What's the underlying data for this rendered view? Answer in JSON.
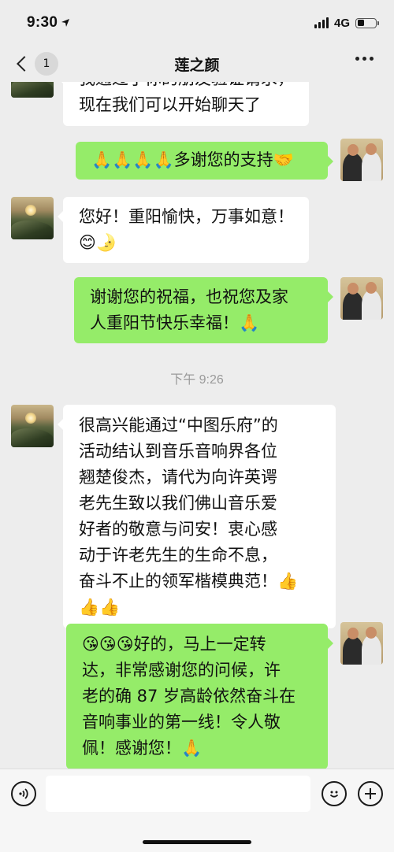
{
  "status_bar": {
    "time": "9:30",
    "network": "4G"
  },
  "nav": {
    "title": "莲之颜",
    "unread_count": "1"
  },
  "messages": [
    {
      "side": "in",
      "lines": [
        "我通过了你的朋友验证请求，",
        "现在我们可以开始聊天了"
      ]
    },
    {
      "side": "out",
      "lines": [
        "🙏🙏🙏🙏多谢您的支持🤝"
      ]
    },
    {
      "side": "in",
      "lines": [
        "您好！重阳愉快，万事如意！",
        "😊🌛"
      ]
    },
    {
      "side": "out",
      "lines": [
        "谢谢您的祝福，也祝您及家",
        "人重阳节快乐幸福！🙏"
      ]
    },
    {
      "side": "in",
      "lines": [
        "很高兴能通过“中图乐府”的",
        "活动结认到音乐音响界各位",
        "翘楚俊杰，请代为向许英谔",
        "老先生致以我们佛山音乐爱",
        "好者的敬意与问安！衷心感",
        "动于许老先生的生命不息，",
        "奋斗不止的领军楷模典范！👍",
        "👍👍"
      ]
    },
    {
      "side": "out",
      "lines": [
        "😘😘😘好的，马上一定转",
        "达，非常感谢您的问候，许",
        "老的确 87 岁高龄依然奋斗在",
        "音响事业的第一线！令人敬",
        "佩！感谢您！🙏"
      ]
    }
  ],
  "time_divider": "下午 9:26",
  "input_bar": {
    "placeholder": ""
  },
  "icons": {
    "back": "chevron-left-icon",
    "more": "more-dots-icon",
    "voice": "voice-icon",
    "emoji": "emoji-icon",
    "add": "plus-icon"
  },
  "colors": {
    "outgoing_bubble": "#95ec69",
    "incoming_bubble": "#ffffff",
    "background": "#ededed"
  }
}
